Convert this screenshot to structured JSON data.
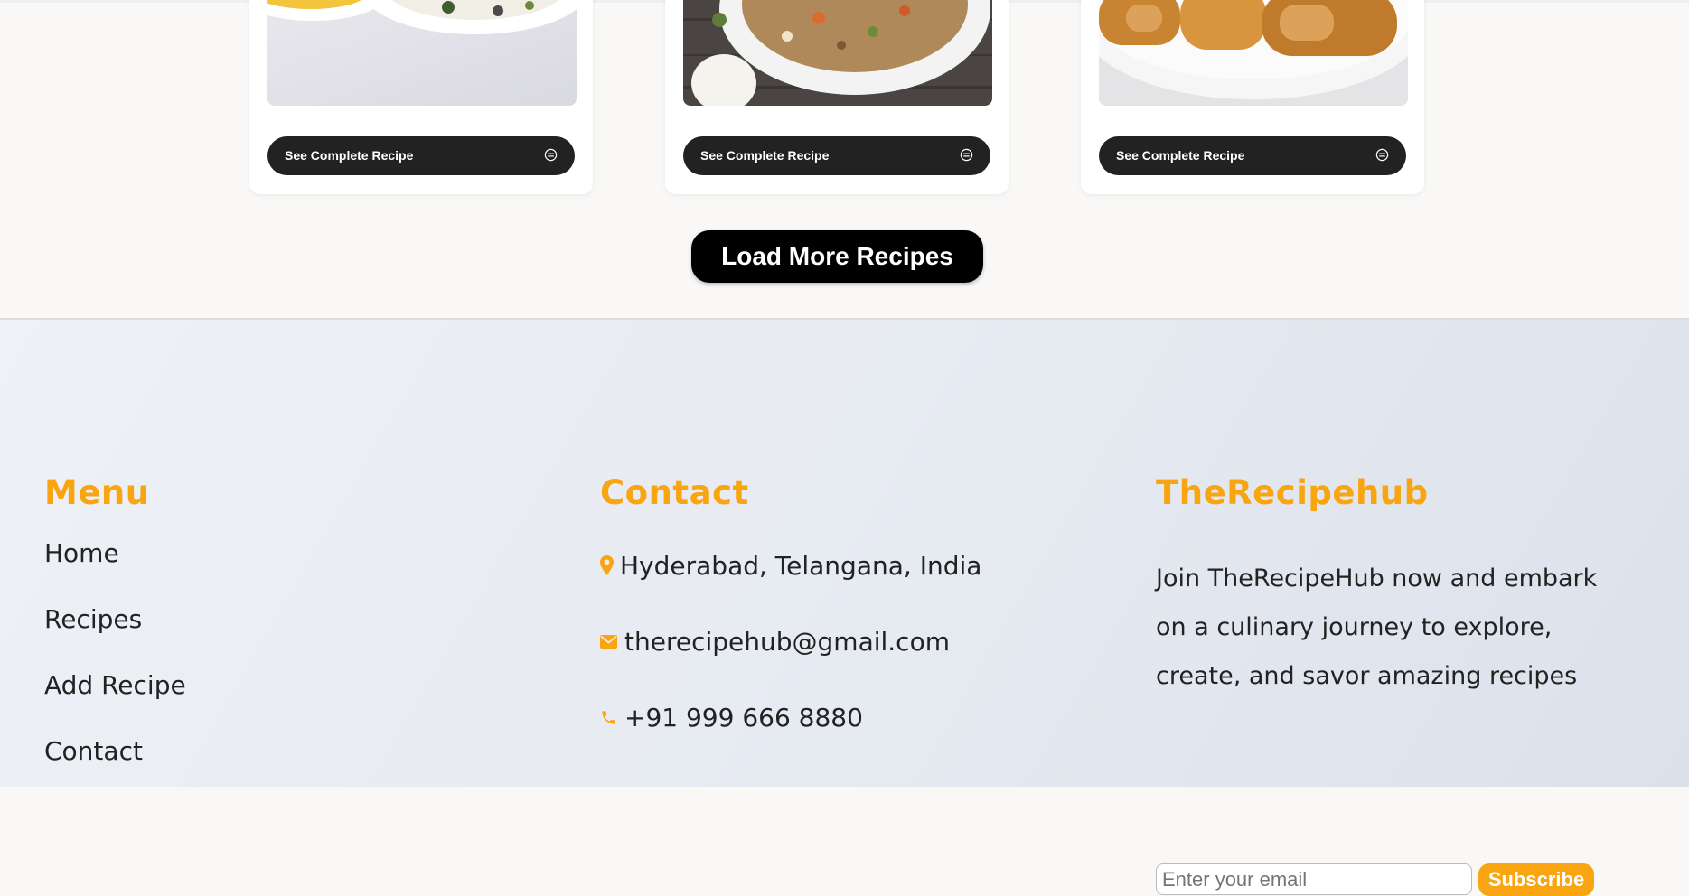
{
  "recipe_cards": [
    {
      "button_label": "See Complete Recipe"
    },
    {
      "button_label": "See Complete Recipe"
    },
    {
      "button_label": "See Complete Recipe"
    }
  ],
  "load_more_label": "Load More Recipes",
  "footer": {
    "menu": {
      "heading": "Menu",
      "links": [
        "Home",
        "Recipes",
        "Add Recipe",
        "Contact"
      ]
    },
    "contact": {
      "heading": "Contact",
      "address": "Hyderabad, Telangana, India",
      "email": "therecipehub@gmail.com",
      "phone": "+91 999 666 8880"
    },
    "about": {
      "heading": "TheRecipehub",
      "text": "Join TheRecipeHub now and embark on a culinary journey to explore, create, and savor amazing recipes",
      "email_placeholder": "Enter your email",
      "subscribe_label": "Subscribe"
    }
  },
  "colors": {
    "accent": "#f9a411",
    "dark_button": "#222222",
    "load_more_bg": "#000000"
  }
}
